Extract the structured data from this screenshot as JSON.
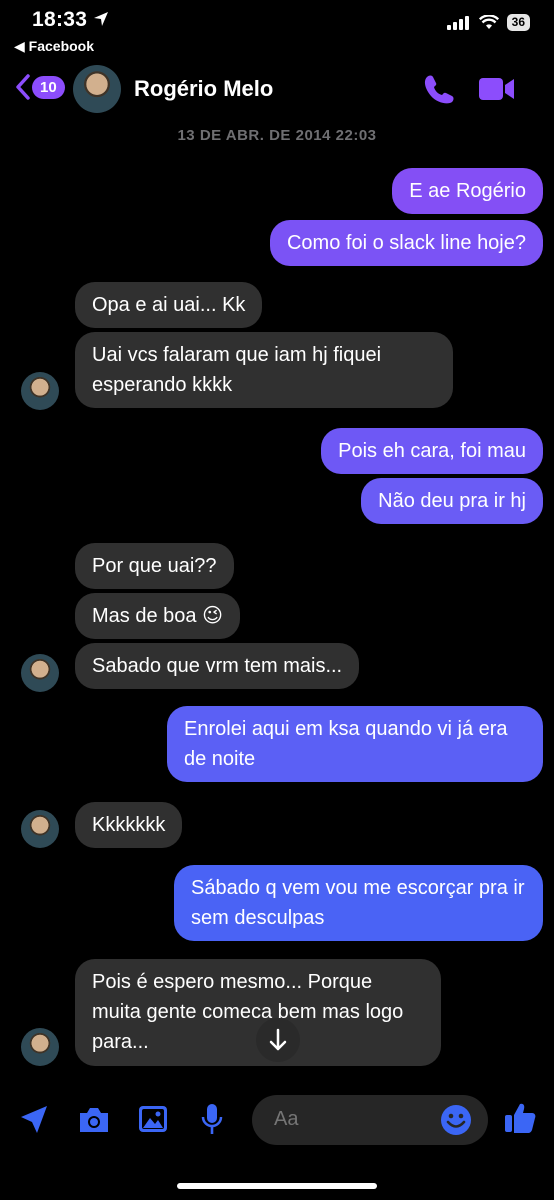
{
  "status_bar": {
    "time": "18:33",
    "back_app": "◀ Facebook",
    "battery": "36"
  },
  "header": {
    "badge": "10",
    "contact_name": "Rogério Melo"
  },
  "date_label": "13 DE ABR. DE 2014 22:03",
  "messages": [
    {
      "dir": "out",
      "text": "E ae Rogério"
    },
    {
      "dir": "out",
      "text": "Como foi o slack line hoje?"
    },
    {
      "dir": "in",
      "text": "Opa e ai uai... Kk"
    },
    {
      "dir": "in",
      "text": "Uai vcs falaram que iam hj fiquei esperando kkkk"
    },
    {
      "dir": "out",
      "text": "Pois eh cara, foi mau"
    },
    {
      "dir": "out",
      "text": "Não deu pra ir hj"
    },
    {
      "dir": "in",
      "text": "Por que uai??"
    },
    {
      "dir": "in",
      "text": "Mas de boa 😉"
    },
    {
      "dir": "in",
      "text": "Sabado que vrm tem mais..."
    },
    {
      "dir": "out",
      "text": "Enrolei aqui em ksa quando vi já era de noite"
    },
    {
      "dir": "in",
      "text": "Kkkkkkk"
    },
    {
      "dir": "out",
      "text": "Sábado q vem vou me escorçar pra ir sem desculpas"
    },
    {
      "dir": "in",
      "text": "Pois é espero mesmo... Porque muita gente comeca bem mas logo para..."
    }
  ],
  "composer": {
    "placeholder": "Aa"
  },
  "icons": {
    "location": "location-arrow-icon",
    "camera": "camera-icon",
    "gallery": "image-icon",
    "mic": "microphone-icon",
    "emoji": "emoji-icon",
    "like": "thumbs-up-icon"
  },
  "colors": {
    "accent": "#8c4dfc",
    "blue": "#3b66f5",
    "incoming": "#303030"
  }
}
